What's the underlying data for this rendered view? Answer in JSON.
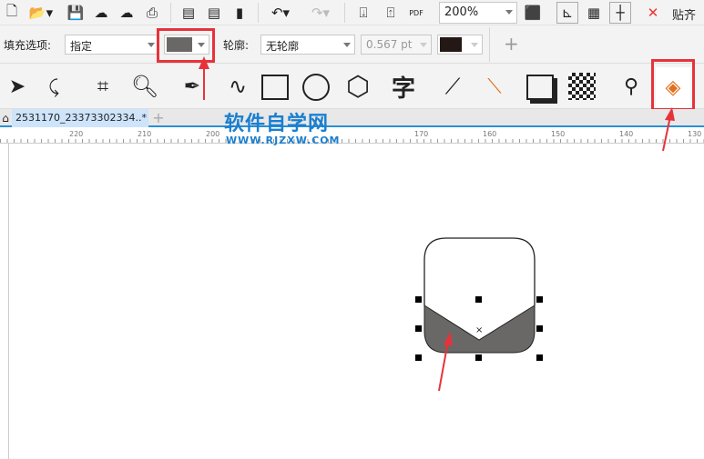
{
  "toolbar": {
    "zoom_value": "200%",
    "snap_label": "贴齐",
    "pdf_label": "PDF"
  },
  "property_bar": {
    "fill_label": "填充选项:",
    "fill_value": "指定",
    "fill_color": "#6a6866",
    "outline_label": "轮廓:",
    "outline_value": "无轮廓",
    "outline_width": "0.567 pt",
    "outline_color": "#231815",
    "add_label": "+"
  },
  "tools": {
    "text_tool": "字"
  },
  "document_tab": {
    "title": "2531170_23373302334..*",
    "add_label": "+"
  },
  "watermark": {
    "title": "软件自学网",
    "url": "WWW.RJZXW.COM"
  },
  "ruler": {
    "labels": [
      "220",
      "210",
      "200",
      "170",
      "160",
      "150",
      "140",
      "130"
    ]
  },
  "colors": {
    "highlight": "#e8323a",
    "accent": "#2a8fd8"
  }
}
